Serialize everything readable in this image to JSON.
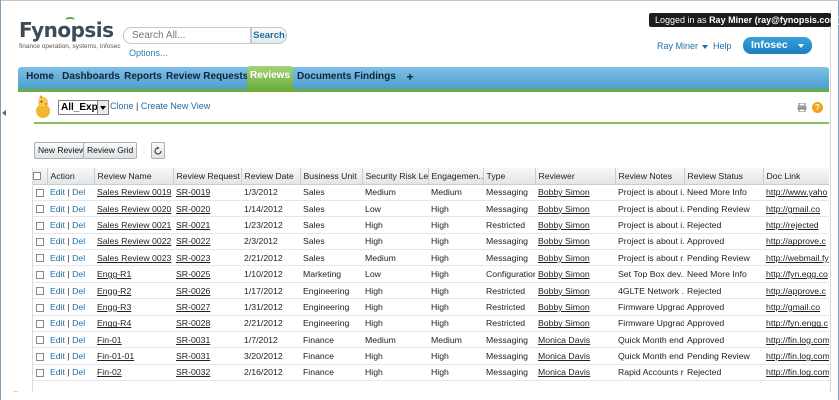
{
  "header": {
    "logo_text": "Fynopsis",
    "logo_tagline": "finance operation, systems, infosec",
    "search_placeholder": "Search All...",
    "search_button": "Search",
    "options_link": "Options...",
    "login_prefix": "Logged in as",
    "login_user": "Ray Miner (ray@fynopsis.com)",
    "user_menu": "Ray Miner",
    "help_link": "Help",
    "app_switcher": "Infosec"
  },
  "tabs": [
    {
      "label": "Home"
    },
    {
      "label": "Dashboards"
    },
    {
      "label": "Reports"
    },
    {
      "label": "Review Requests"
    },
    {
      "label": "Reviews",
      "active": true
    },
    {
      "label": "Documents"
    },
    {
      "label": "Findings"
    },
    {
      "label": "+"
    }
  ],
  "view": {
    "selected_view": "All_Exp",
    "clone_link": "Clone",
    "separator": "|",
    "create_link": "Create New View"
  },
  "toolbar": {
    "new_review": "New Review",
    "review_grid": "Review Grid"
  },
  "grid": {
    "columns": [
      "",
      "Action",
      "Review Name",
      "Review Request",
      "Review Date",
      "Business Unit",
      "Security Risk Le...",
      "Engagemen...",
      "Type",
      "Reviewer",
      "Review Notes",
      "Review Status",
      "Doc Link"
    ],
    "sorted_column": "Review Request",
    "action_edit": "Edit",
    "action_sep": "|",
    "action_del": "Del",
    "rows": [
      [
        "Sales Review 0019",
        "SR-0019",
        "1/3/2012",
        "Sales",
        "Medium",
        "Medium",
        "Messaging",
        "Bobby Simon",
        "Project is about i...",
        "Need More Info",
        "http://www.yaho"
      ],
      [
        "Sales Review 0020",
        "SR-0020",
        "1/14/2012",
        "Sales",
        "Low",
        "High",
        "Messaging",
        "Bobby Simon",
        "Project is about i...",
        "Pending Review",
        "http://gmail.co"
      ],
      [
        "Sales Review 0021",
        "SR-0021",
        "1/23/2012",
        "Sales",
        "High",
        "High",
        "Restricted",
        "Bobby Simon",
        "Project is about i...",
        "Rejected",
        "http://rejected"
      ],
      [
        "Sales Review 0022",
        "SR-0022",
        "2/3/2012",
        "Sales",
        "High",
        "High",
        "Messaging",
        "Bobby Simon",
        "Project is about i...",
        "Approved",
        "http://approve.c"
      ],
      [
        "Sales Review 0023",
        "SR-0023",
        "2/21/2012",
        "Sales",
        "Medium",
        "High",
        "Messaging",
        "Bobby Simon",
        "Project is about r...",
        "Pending Review",
        "http://webmail.fy"
      ],
      [
        "Engg-R1",
        "SR-0025",
        "1/10/2012",
        "Marketing",
        "Low",
        "High",
        "Configuration",
        "Bobby Simon",
        "Set Top Box dev...",
        "Need More Info",
        "http://fyn.egg.co"
      ],
      [
        "Engg-R2",
        "SR-0026",
        "1/17/2012",
        "Engineering",
        "High",
        "High",
        "Restricted",
        "Bobby Simon",
        "4GLTE Network ...",
        "Rejected",
        "http://approve.c"
      ],
      [
        "Engg-R3",
        "SR-0027",
        "1/31/2012",
        "Engineering",
        "High",
        "High",
        "Restricted",
        "Bobby Simon",
        "Firmware Upgrad...",
        "Approved",
        "http://gmail.co"
      ],
      [
        "Engg-R4",
        "SR-0028",
        "2/21/2012",
        "Engineering",
        "High",
        "High",
        "Restricted",
        "Bobby Simon",
        "Firmware Upgrad...",
        "Approved",
        "http://fyn.engg.c"
      ],
      [
        "Fin-01",
        "SR-0031",
        "1/7/2012",
        "Finance",
        "Medium",
        "Medium",
        "Messaging",
        "Monica Davis",
        "Quick Month end...",
        "Approved",
        "http://fin.log.com"
      ],
      [
        "Fin-01-01",
        "SR-0031",
        "3/20/2012",
        "Finance",
        "High",
        "High",
        "Messaging",
        "Monica Davis",
        "Quick Month end...",
        "Pending Review",
        "http://fin.log.com"
      ],
      [
        "Fin-02",
        "SR-0032",
        "2/16/2012",
        "Finance",
        "High",
        "High",
        "Messaging",
        "Monica Davis",
        "Rapid Accounts r...",
        "Rejected",
        "http://fin.log.com"
      ]
    ]
  },
  "icons": {
    "print": "printer-icon",
    "help": "help-icon",
    "refresh": "refresh-icon",
    "mascot": "mascot-icon"
  },
  "colors": {
    "tab_bar": "#4c9fd0",
    "active_tab": "#6fae3e",
    "link": "#1f6ea3",
    "app_switcher": "#1b7ec0"
  }
}
